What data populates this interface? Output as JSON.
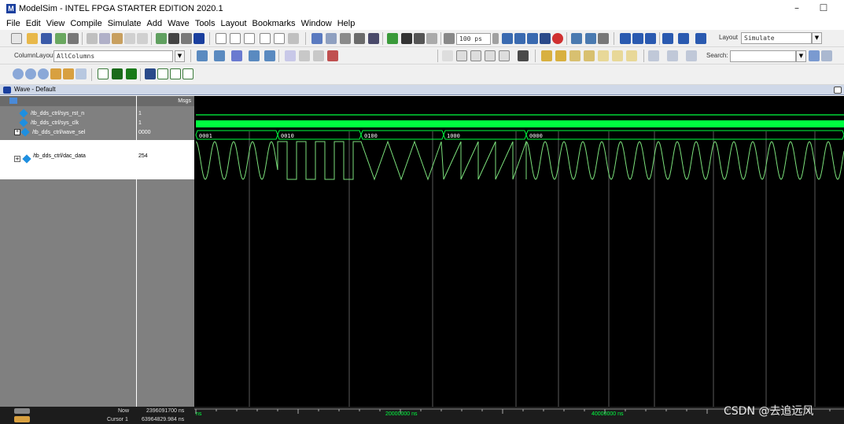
{
  "app": {
    "title": "ModelSim - INTEL FPGA STARTER EDITION 2020.1",
    "logo_text": "M",
    "window_controls": {
      "minimize": "–",
      "maximize": "☐"
    }
  },
  "menu": [
    "File",
    "Edit",
    "View",
    "Compile",
    "Simulate",
    "Add",
    "Wave",
    "Tools",
    "Layout",
    "Bookmarks",
    "Window",
    "Help"
  ],
  "toolbar": {
    "run_length": "100 ps",
    "layout_label": "Layout",
    "layout_value": "Simulate",
    "column_layout_label": "ColumnLayout",
    "column_layout_value": "AllColumns",
    "search_label": "Search:",
    "search_value": ""
  },
  "wave_window": {
    "title": "Wave - Default",
    "msgs_header": "Msgs",
    "signals": [
      {
        "name": "/tb_dds_ctrl/sys_rst_n",
        "value": "1"
      },
      {
        "name": "/tb_dds_ctrl/sys_clk",
        "value": "1"
      },
      {
        "name": "/tb_dds_ctrl/wave_sel",
        "value": "0000"
      },
      {
        "name": "/tb_dds_ctrl/dac_data",
        "value": "254"
      }
    ],
    "wave_sel_segments": [
      "0001",
      "0010",
      "0100",
      "1000",
      "0000"
    ],
    "timeline_labels": [
      "ns",
      "20000000 ns",
      "40000000 ns"
    ],
    "now_label": "Now",
    "now_value": "2396091700 ns",
    "cursor_label": "Cursor 1",
    "cursor_value": "63964829.984 ns"
  },
  "colors": {
    "wave_green": "#00ff40",
    "analog_green": "#7be07b",
    "grid": "#5a5a5a"
  },
  "watermark": "CSDN @去追远风"
}
